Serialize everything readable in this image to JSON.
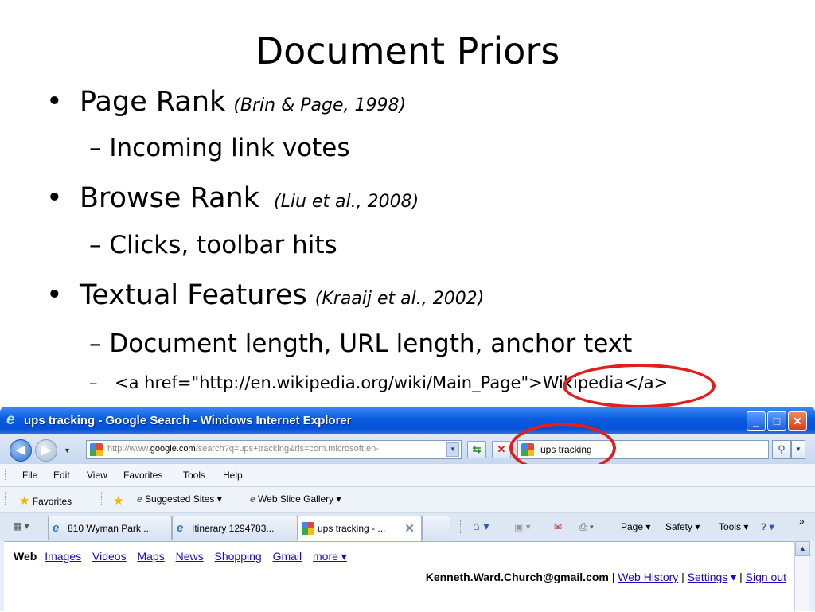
{
  "slide": {
    "title": "Document Priors",
    "items": [
      {
        "bullet": "•",
        "label": "Page Rank",
        "cite": "(Brin & Page, 1998)",
        "sub": "– Incoming link votes"
      },
      {
        "bullet": "•",
        "label": "Browse Rank",
        "cite": "(Liu et al., 2008)",
        "sub": "– Clicks, toolbar hits"
      },
      {
        "bullet": "•",
        "label": "Textual Features",
        "cite": "(Kraaij et al., 2002)",
        "sub": "– Document length, URL length, anchor text",
        "sub2_dash": "–",
        "sub2": "<a href=\"http://en.wikipedia.org/wiki/Main_Page\">Wikipedia</a>"
      }
    ]
  },
  "ie": {
    "window_title": "ups tracking - Google Search - Windows Internet Explorer",
    "window_buttons": {
      "minimize": "_",
      "maximize": "□",
      "close": "✕"
    },
    "address": {
      "url_prefix": "http://www.",
      "url_domain": "google.com",
      "url_rest": "/search?q=ups+tracking&rls=com.microsoft:en-"
    },
    "search_box": {
      "value": "ups tracking"
    },
    "menu": [
      "File",
      "Edit",
      "View",
      "Favorites",
      "Tools",
      "Help"
    ],
    "favorites_bar": {
      "favorites": "Favorites",
      "suggested_sites": "Suggested Sites ▾",
      "web_slice_gallery": "Web Slice Gallery ▾"
    },
    "tabs": [
      {
        "label": "810 Wyman Park ..."
      },
      {
        "label": "Itinerary 1294783..."
      },
      {
        "label": "ups tracking - ...",
        "active": true
      }
    ],
    "command_bar": {
      "page": "Page ▾",
      "safety": "Safety ▾",
      "tools": "Tools ▾",
      "chevron": "»"
    },
    "google_nav": {
      "current": "Web",
      "links": [
        "Images",
        "Videos",
        "Maps",
        "News",
        "Shopping",
        "Gmail"
      ],
      "more": "more ▾"
    },
    "user_line": {
      "email": "Kenneth.Ward.Church@gmail.com",
      "sep": "|",
      "web_history": "Web History",
      "settings": "Settings",
      "settings_arrow": "▾",
      "sign_out": "Sign out"
    }
  },
  "colors": {
    "annotation_ring": "#e01f1f",
    "ie_titlebar": "#0a5ce0",
    "link": "#2200cc"
  }
}
